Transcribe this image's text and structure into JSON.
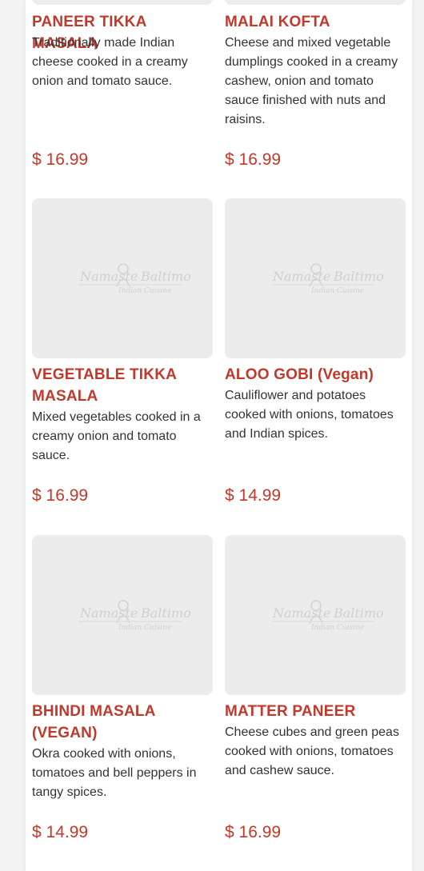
{
  "menu": {
    "logo": {
      "line1": "Namaste",
      "line2": "Baltimore",
      "tagline": "Indian Cuisine"
    },
    "items": [
      {
        "title": "PANEER TIKKA MASALA",
        "description": "Traditionally made Indian cheese cooked in a creamy onion and tomato sauce.",
        "price": "$ 16.99"
      },
      {
        "title": "MALAI KOFTA",
        "description": "Cheese and mixed vegetable dumplings cooked in a creamy cashew, onion and tomato sauce finished with nuts and raisins.",
        "price": "$ 16.99"
      },
      {
        "title": "VEGETABLE TIKKA MASALA",
        "description": "Mixed vegetables cooked in a creamy onion and tomato sauce.",
        "price": "$ 16.99"
      },
      {
        "title": "ALOO GOBI (Vegan)",
        "description": "Cauliflower and potatoes cooked with onions, tomatoes and Indian spices.",
        "price": "$ 14.99"
      },
      {
        "title": "BHINDI MASALA (VEGAN)",
        "description": "Okra cooked with onions, tomatoes and bell peppers in tangy spices.",
        "price": "$ 14.99"
      },
      {
        "title": "MATTER PANEER",
        "description": "Cheese cubes and green peas cooked with onions, tomatoes and cashew sauce.",
        "price": "$ 16.99"
      }
    ]
  },
  "colors": {
    "accent": "#c0392b",
    "text": "#333333",
    "placeholder": "#ececec"
  }
}
